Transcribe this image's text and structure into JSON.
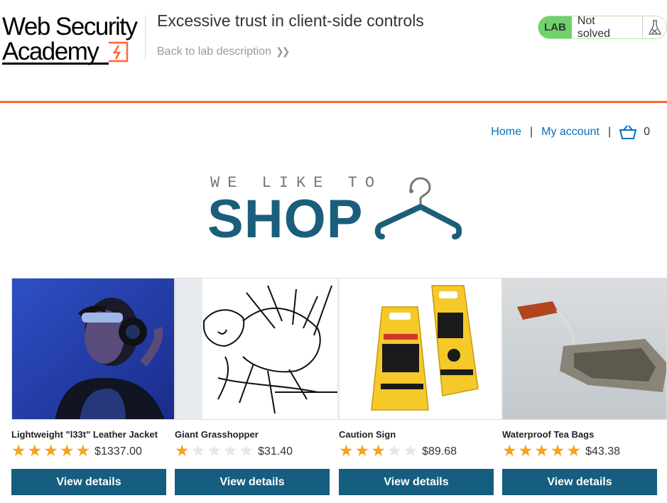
{
  "header": {
    "logo_line1": "Web Security",
    "logo_line2": "Academy",
    "lab_title": "Excessive trust in client-side controls",
    "back_link": "Back to lab description",
    "status_tag": "LAB",
    "status_text": "Not solved"
  },
  "nav": {
    "home": "Home",
    "separator": "|",
    "account": "My account",
    "cart_count": "0"
  },
  "banner": {
    "tagline": "WE LIKE TO",
    "word": "SHOP"
  },
  "products": [
    {
      "name": "Lightweight \"l33t\" Leather Jacket",
      "rating": 5,
      "price": "$1337.00",
      "button": "View details"
    },
    {
      "name": "Giant Grasshopper",
      "rating": 1,
      "price": "$31.40",
      "button": "View details"
    },
    {
      "name": "Caution Sign",
      "rating": 3,
      "price": "$89.68",
      "button": "View details"
    },
    {
      "name": "Waterproof Tea Bags",
      "rating": 5,
      "price": "$43.38",
      "button": "View details"
    }
  ],
  "colors": {
    "accent_orange": "#ff6633",
    "brand_blue": "#155e7f",
    "link_blue": "#0071bc",
    "star_gold": "#f7a21b",
    "lab_green": "#70d16d"
  }
}
